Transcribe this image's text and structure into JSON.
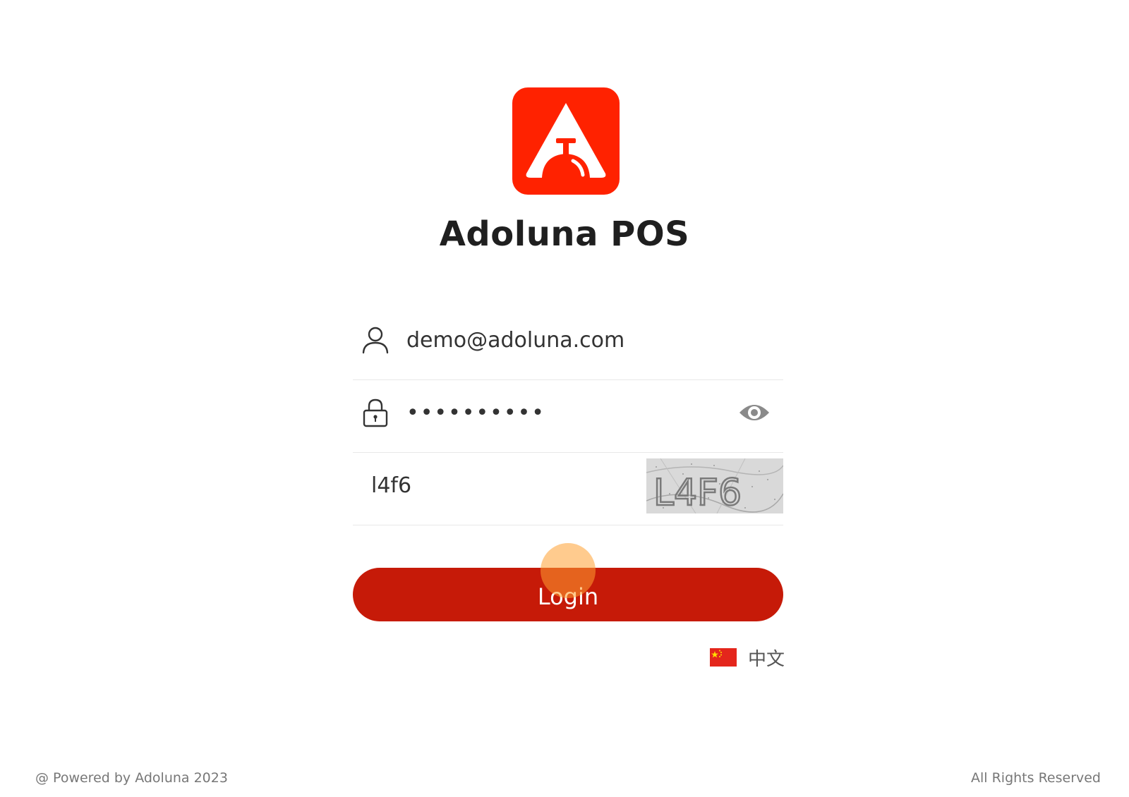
{
  "app": {
    "title": "Adoluna POS",
    "brand_color": "#ff2200"
  },
  "form": {
    "email": {
      "value": "demo@adoluna.com",
      "icon": "user-icon"
    },
    "password": {
      "masked_value": "••••••••••",
      "icon": "lock-icon",
      "toggle_icon": "eye-icon"
    },
    "captcha": {
      "value": "l4f6",
      "image_text": "L4F6"
    },
    "login_label": "Login",
    "login_color": "#c61a08"
  },
  "language": {
    "label": "中文",
    "flag": "china-flag-icon"
  },
  "footer": {
    "left": "@ Powered by Adoluna 2023",
    "right": "All Rights Reserved"
  }
}
